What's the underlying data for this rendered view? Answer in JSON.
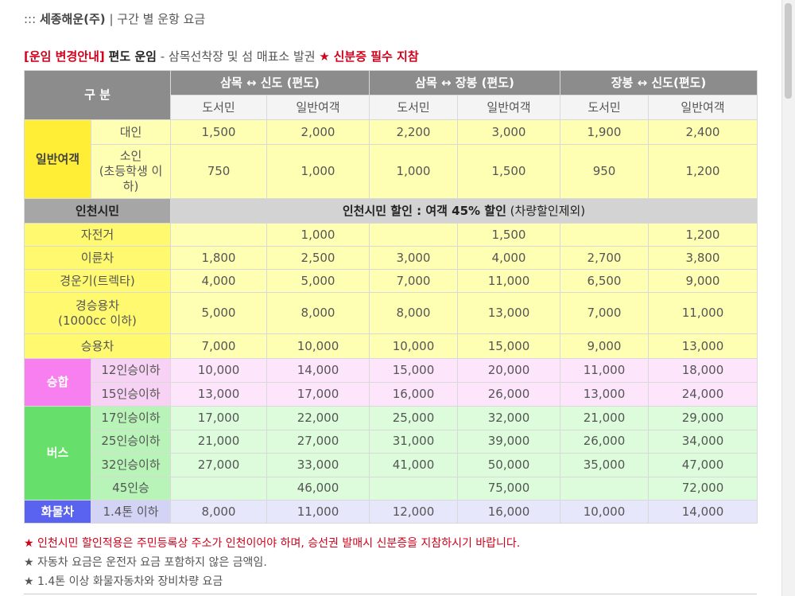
{
  "breadcrumb": {
    "prefix": ":::",
    "company": "세종해운(주)",
    "separator": "|",
    "title": "구간 별 운항 요금"
  },
  "notice": {
    "tag": "[운임 변경안내]",
    "fare_type": "편도 운임",
    "text": "- 삼목선착장 및 섬 매표소 발권",
    "star": "★",
    "warning": "신분증 필수 지참"
  },
  "table": {
    "corner": "구 분",
    "routes": [
      "삼목 ↔ 신도 (편도)",
      "삼목 ↔ 장봉 (편도)",
      "장봉 ↔ 신도(편도)"
    ],
    "sub_headers": [
      "도서민",
      "일반여객",
      "도서민",
      "일반여객",
      "도서민",
      "일반여객"
    ],
    "general": {
      "label": "일반여객",
      "rows": [
        {
          "sub": "대인",
          "values": [
            "1,500",
            "2,000",
            "2,200",
            "3,000",
            "1,900",
            "2,400"
          ]
        },
        {
          "sub": "소인\n(초등학생 이하)",
          "values": [
            "750",
            "1,000",
            "1,000",
            "1,500",
            "950",
            "1,200"
          ]
        }
      ]
    },
    "incheon": {
      "label": "인천시민",
      "bold_text": "인천시민 할인 : 여객 45% 할인",
      "note": "(차량할인제외)"
    },
    "vehicles": [
      {
        "label": "자전거",
        "values": [
          "",
          "1,000",
          "",
          "1,500",
          "",
          "1,200"
        ]
      },
      {
        "label": "이륜차",
        "values": [
          "1,800",
          "2,500",
          "3,000",
          "4,000",
          "2,700",
          "3,800"
        ]
      },
      {
        "label": "경운기(트렉타)",
        "values": [
          "4,000",
          "5,000",
          "7,000",
          "11,000",
          "6,500",
          "9,000"
        ]
      },
      {
        "label": "경승용차\n(1000cc 이하)",
        "values": [
          "5,000",
          "8,000",
          "8,000",
          "13,000",
          "7,000",
          "11,000"
        ]
      },
      {
        "label": "승용차",
        "values": [
          "7,000",
          "10,000",
          "10,000",
          "15,000",
          "9,000",
          "13,000"
        ]
      }
    ],
    "van": {
      "label": "승합",
      "rows": [
        {
          "sub": "12인승이하",
          "values": [
            "10,000",
            "14,000",
            "15,000",
            "20,000",
            "11,000",
            "18,000"
          ]
        },
        {
          "sub": "15인승이하",
          "values": [
            "13,000",
            "17,000",
            "16,000",
            "26,000",
            "13,000",
            "24,000"
          ]
        }
      ]
    },
    "bus": {
      "label": "버스",
      "rows": [
        {
          "sub": "17인승이하",
          "values": [
            "17,000",
            "22,000",
            "25,000",
            "32,000",
            "21,000",
            "29,000"
          ]
        },
        {
          "sub": "25인승이하",
          "values": [
            "21,000",
            "27,000",
            "31,000",
            "39,000",
            "26,000",
            "34,000"
          ]
        },
        {
          "sub": "32인승이하",
          "values": [
            "27,000",
            "33,000",
            "41,000",
            "50,000",
            "35,000",
            "47,000"
          ]
        },
        {
          "sub": "45인승",
          "values": [
            "",
            "46,000",
            "",
            "75,000",
            "",
            "72,000"
          ]
        }
      ]
    },
    "truck": {
      "label": "화물차",
      "sub": "1.4톤 이하",
      "values": [
        "8,000",
        "11,000",
        "12,000",
        "16,000",
        "10,000",
        "14,000"
      ]
    }
  },
  "footnotes": [
    {
      "star": "★",
      "text": "인천시민 할인적용은 주민등록상 주소가 인천이어야 하며, 승선권 발매시 신분증을 지참하시기 바랍니다.",
      "emphasis": true
    },
    {
      "star": "★",
      "text": "자동차 요금은 운전자 요금 포함하지 않은 금액임.",
      "emphasis": false
    },
    {
      "star": "★",
      "text": "1.4톤 이상 화물자동차와 장비차량 요금",
      "emphasis": false
    }
  ],
  "colors": {
    "header_gray": "#8c8c8c",
    "yellow": "#ffee35",
    "pink": "#f77ff0",
    "green": "#66e06a",
    "blue": "#5a62f0",
    "alert_red": "#d0021b"
  }
}
